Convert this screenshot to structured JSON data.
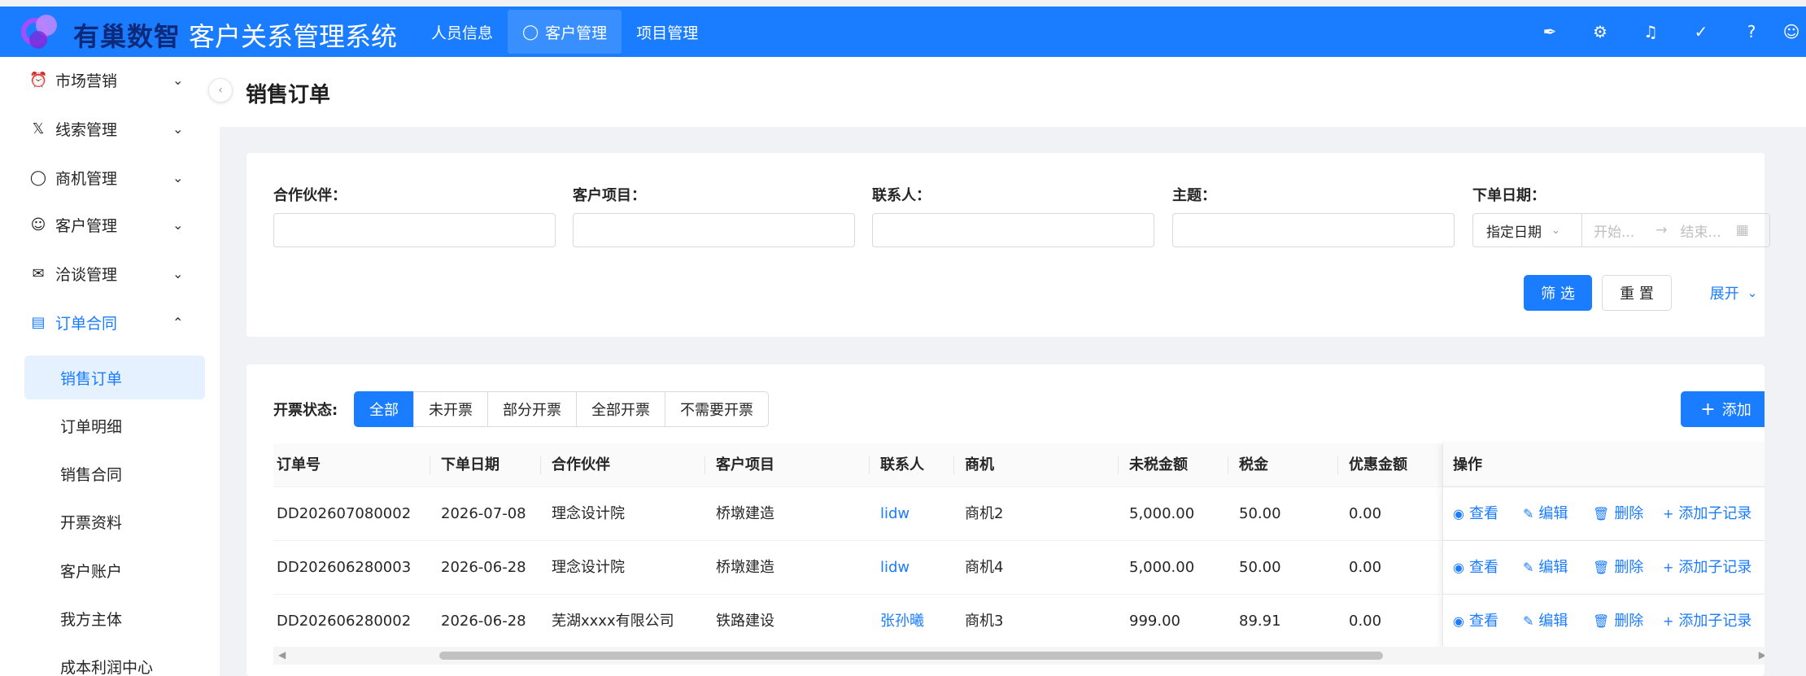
{
  "header": {
    "brand": "有巢数智",
    "system_title": "客户关系管理系统",
    "nav": [
      {
        "label": "人员信息"
      },
      {
        "label": "客户管理"
      },
      {
        "label": "项目管理"
      }
    ],
    "icons": [
      "broom-icon",
      "gear-icon",
      "bell-icon",
      "check-circle-icon",
      "help-icon",
      "user-icon"
    ]
  },
  "sidebar": {
    "menus": [
      {
        "label": "市场营销"
      },
      {
        "label": "线索管理"
      },
      {
        "label": "商机管理"
      },
      {
        "label": "客户管理"
      },
      {
        "label": "洽谈管理"
      },
      {
        "label": "订单合同"
      }
    ],
    "subitems": [
      {
        "label": "销售订单"
      },
      {
        "label": "订单明细"
      },
      {
        "label": "销售合同"
      },
      {
        "label": "开票资料"
      },
      {
        "label": "客户账户"
      },
      {
        "label": "我方主体"
      },
      {
        "label": "成本利润中心"
      }
    ]
  },
  "page": {
    "title": "销售订单"
  },
  "filters": {
    "partner_label": "合作伙伴：",
    "project_label": "客户项目：",
    "contact_label": "联系人：",
    "subject_label": "主题：",
    "date_label": "下单日期：",
    "date_type": "指定日期",
    "start_placeholder": "开始...",
    "end_placeholder": "结束...",
    "filter_button": "筛 选",
    "reset_button": "重 置",
    "expand_button": "展开"
  },
  "invoice": {
    "label": "开票状态:",
    "options": [
      "全部",
      "未开票",
      "部分开票",
      "全部开票",
      "不需要开票"
    ],
    "selected": "全部",
    "add_button": "添加"
  },
  "table": {
    "columns": [
      "订单号",
      "下单日期",
      "合作伙伴",
      "客户项目",
      "联系人",
      "商机",
      "未税金额",
      "税金",
      "优惠金额",
      "操作"
    ],
    "rows": [
      {
        "order_no": "DD202607080002",
        "date": "2026-07-08",
        "partner": "理念设计院",
        "project": "桥墩建造",
        "contact": "lidw",
        "opportunity": "商机2",
        "untaxed": "5,000.00",
        "tax": "50.00",
        "discount": "0.00"
      },
      {
        "order_no": "DD202606280003",
        "date": "2026-06-28",
        "partner": "理念设计院",
        "project": "桥墩建造",
        "contact": "lidw",
        "opportunity": "商机4",
        "untaxed": "5,000.00",
        "tax": "50.00",
        "discount": "0.00"
      },
      {
        "order_no": "DD202606280002",
        "date": "2026-06-28",
        "partner": "芜湖xxxx有限公司",
        "project": "铁路建设",
        "contact": "张孙曦",
        "opportunity": "商机3",
        "untaxed": "999.00",
        "tax": "89.91",
        "discount": "0.00"
      }
    ],
    "actions": [
      "查看",
      "编辑",
      "删除",
      "添加子记录"
    ]
  }
}
